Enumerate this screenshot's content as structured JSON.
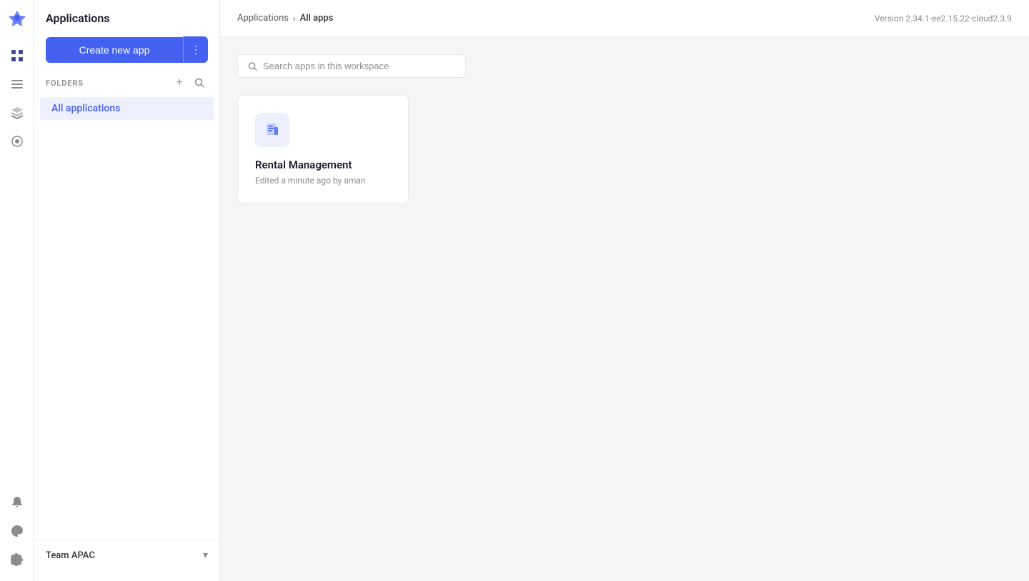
{
  "app": {
    "version": "Version 2.34.1-ee2.15.22-cloud2.3.9"
  },
  "icon_sidebar": {
    "logo_icon": "rocket",
    "nav_items": [
      {
        "id": "grid",
        "label": "Grid",
        "active": true
      },
      {
        "id": "list",
        "label": "List"
      },
      {
        "id": "layers",
        "label": "Layers"
      },
      {
        "id": "filter",
        "label": "Filter"
      }
    ],
    "bottom_items": [
      {
        "id": "notifications",
        "label": "Notifications"
      },
      {
        "id": "theme",
        "label": "Theme"
      },
      {
        "id": "settings",
        "label": "Settings"
      }
    ]
  },
  "sidebar": {
    "title": "Applications",
    "create_button_label": "Create new app",
    "create_menu_icon": "⋮",
    "folders_label": "FOLDERS",
    "add_folder_icon": "+",
    "search_folder_icon": "search",
    "folders": [
      {
        "id": "all",
        "label": "All applications",
        "active": true
      }
    ],
    "bottom": {
      "team_name": "Team APAC",
      "chevron": "▾"
    }
  },
  "breadcrumb": {
    "parent": "Applications",
    "separator": "›",
    "current": "All apps"
  },
  "search": {
    "placeholder": "Search apps in this workspace"
  },
  "apps": [
    {
      "id": "rental-management",
      "name": "Rental Management",
      "meta": "Edited a minute ago by aman"
    }
  ]
}
